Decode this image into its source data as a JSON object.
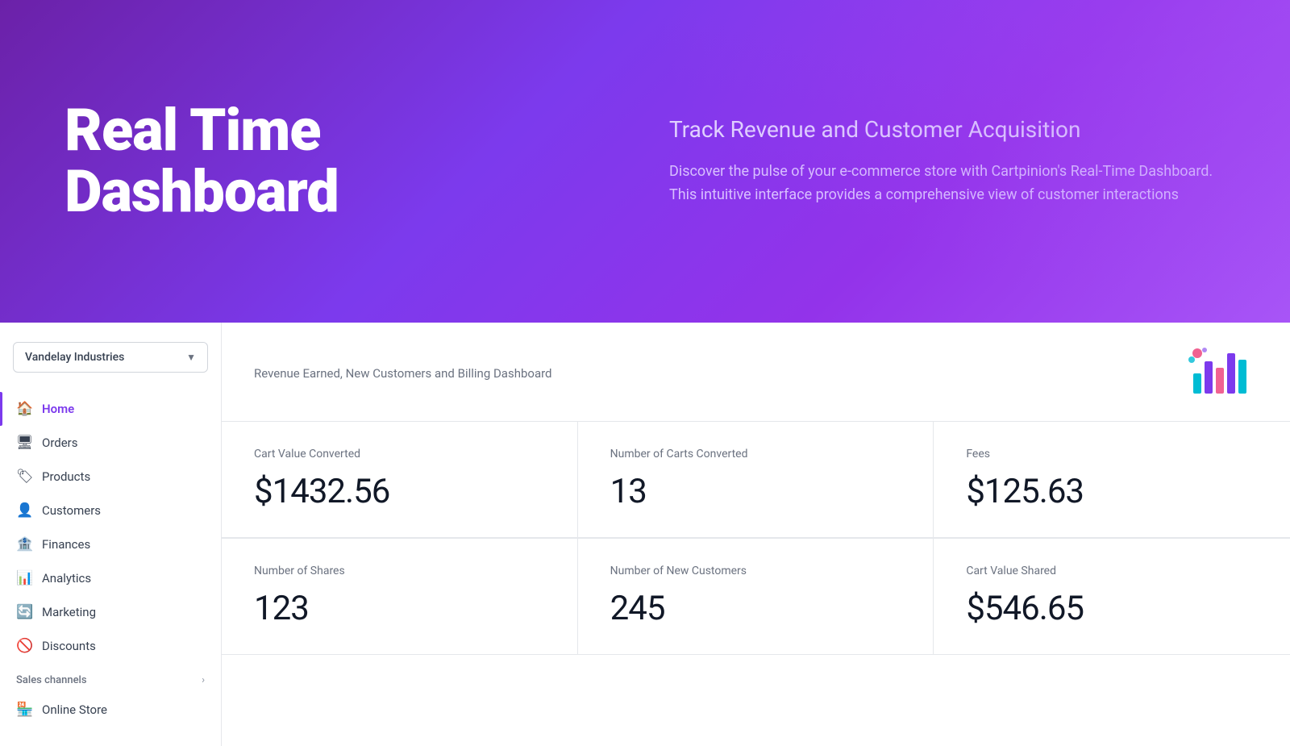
{
  "hero": {
    "title": "Real Time\nDashboard",
    "subtitle": "Track Revenue and Customer Acquisition",
    "description": "Discover the pulse of your e-commerce store with Cartpinion's Real-Time Dashboard. This intuitive interface provides a comprehensive view of customer interactions"
  },
  "sidebar": {
    "store_selector": "Vandelay Industries",
    "nav_items": [
      {
        "id": "home",
        "label": "Home",
        "icon": "🏠",
        "active": true
      },
      {
        "id": "orders",
        "label": "Orders",
        "icon": "🖥",
        "active": false
      },
      {
        "id": "products",
        "label": "Products",
        "icon": "🏷",
        "active": false
      },
      {
        "id": "customers",
        "label": "Customers",
        "icon": "👤",
        "active": false
      },
      {
        "id": "finances",
        "label": "Finances",
        "icon": "🏦",
        "active": false
      },
      {
        "id": "analytics",
        "label": "Analytics",
        "icon": "📊",
        "active": false
      },
      {
        "id": "marketing",
        "label": "Marketing",
        "icon": "🔄",
        "active": false
      },
      {
        "id": "discounts",
        "label": "Discounts",
        "icon": "🚫",
        "active": false
      }
    ],
    "sales_channels_label": "Sales channels",
    "online_store_label": "Online Store"
  },
  "dashboard": {
    "header_title": "Revenue Earned, New Customers and Billing Dashboard",
    "metrics": [
      {
        "id": "cart-value-converted",
        "label": "Cart Value Converted",
        "value": "$1432.56"
      },
      {
        "id": "number-of-carts-converted",
        "label": "Number of Carts Converted",
        "value": "13"
      },
      {
        "id": "fees",
        "label": "Fees",
        "value": "$125.63"
      },
      {
        "id": "number-of-shares",
        "label": "Number of Shares",
        "value": "123"
      },
      {
        "id": "number-of-new-customers",
        "label": "Number of New Customers",
        "value": "245"
      },
      {
        "id": "cart-value-shared",
        "label": "Cart Value Shared",
        "value": "$546.65"
      }
    ]
  }
}
